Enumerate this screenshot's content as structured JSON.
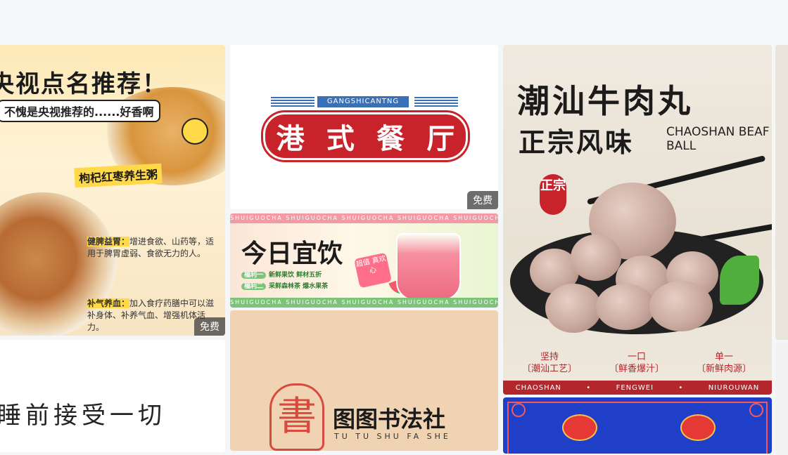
{
  "cards": {
    "porridge": {
      "title": "央视点名推荐！",
      "subtitle": "不愧是央视推荐的......好香啊",
      "tag": "枸杞红枣养生粥",
      "note1_key": "健脾益胃：",
      "note1_text": "增进食欲、山药等，适用于脾胃虚弱、食欲无力的人。",
      "note2_key": "补气养血：",
      "note2_text": "加入食疗药膳中可以滋补身体、补养气血、增强机体活力。",
      "badge": "免费"
    },
    "hk_restaurant": {
      "pinyin": "GANGSHICANTNG",
      "chars": [
        "港",
        "式",
        "餐",
        "厅"
      ],
      "badge": "免费"
    },
    "drink_banner": {
      "band_text": "SHUIGUOCHA   SHUIGUOCHA   SHUIGUOCHA   SHUIGUOCHA   SHUIGUOCHA   SHUIGUOCHA",
      "title": "今日宜饮",
      "pill1_tag": "福利一",
      "pill1_text": "新鲜果饮 鲜材五折",
      "pill2_tag": "福利二",
      "pill2_text": "采鲜森林茶 爆水果茶",
      "stamp": "超值 真欢心"
    },
    "calligraphy": {
      "seal_char": "書",
      "name": "图图书法社",
      "pinyin": "TU TU SHU FA SHE"
    },
    "handwriting": {
      "text": "睡前接受一切"
    },
    "beef_ball": {
      "title_line1": "潮汕牛肉丸",
      "title_line2": "正宗风味",
      "english": "CHAOSHAN BEAF BALL",
      "red_tag": "正宗",
      "features": [
        {
          "line1": "坚持",
          "line2": "〔潮汕工艺〕"
        },
        {
          "line1": "一口",
          "line2": "〔鲜香爆汁〕"
        },
        {
          "line1": "单一",
          "line2": "〔新鲜肉源〕"
        }
      ],
      "footer": [
        "CHAOSHAN",
        "•",
        "FENGWEI",
        "•",
        "NIUROUWAN"
      ]
    }
  },
  "colors": {
    "hk_red": "#c8232b",
    "hk_blue": "#3a70b5",
    "beef_red": "#b3262c",
    "lantern_bg": "#1f3fc9"
  }
}
